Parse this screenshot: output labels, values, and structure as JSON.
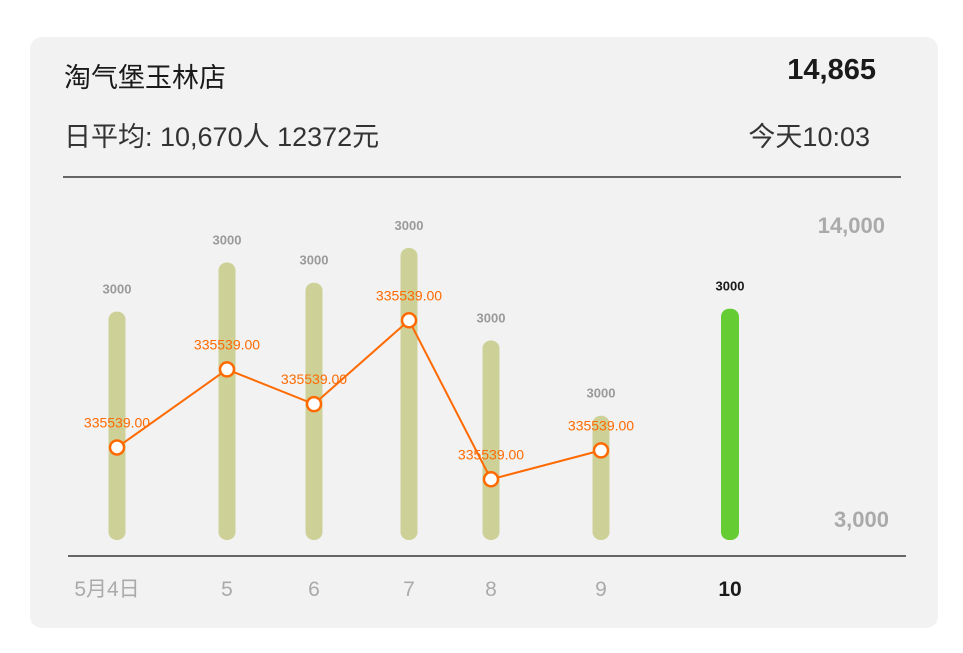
{
  "header": {
    "store_name": "淘气堡玉林店",
    "total": "14,865",
    "daily_average": "日平均: 10,670人   12372元",
    "updated": "今天10:03"
  },
  "colors": {
    "bar": "#cdd198",
    "bar_current": "#66cc33",
    "line": "#ff6a00",
    "bar_label": "#9a9a9a",
    "bar_label_current": "#1a1a1a",
    "axis_label": "#aaaaaa",
    "axis_label_current": "#1a1a1a",
    "line_label": "#ff6a00"
  },
  "chart_data": {
    "type": "bar",
    "categories": [
      "5月4日",
      "5",
      "6",
      "7",
      "8",
      "9",
      "10"
    ],
    "current_index": 6,
    "ylim": [
      3000,
      14000
    ],
    "y_ticks": [
      "14,000",
      "3,000"
    ],
    "grid": false,
    "series": [
      {
        "type": "bar",
        "values": [
          10900,
          12600,
          11900,
          13100,
          9900,
          7300,
          11000
        ],
        "labels": [
          "3000",
          "3000",
          "3000",
          "3000",
          "3000",
          "3000",
          "3000"
        ]
      },
      {
        "type": "line",
        "values": [
          6200,
          8900,
          7700,
          10600,
          5100,
          null,
          null
        ],
        "labels": [
          "335539.00",
          "335539.00",
          "335539.00",
          "335539.00",
          "335539.00",
          "335539.00"
        ]
      }
    ],
    "line_extra_point": {
      "category": "9",
      "value": 6100
    }
  }
}
